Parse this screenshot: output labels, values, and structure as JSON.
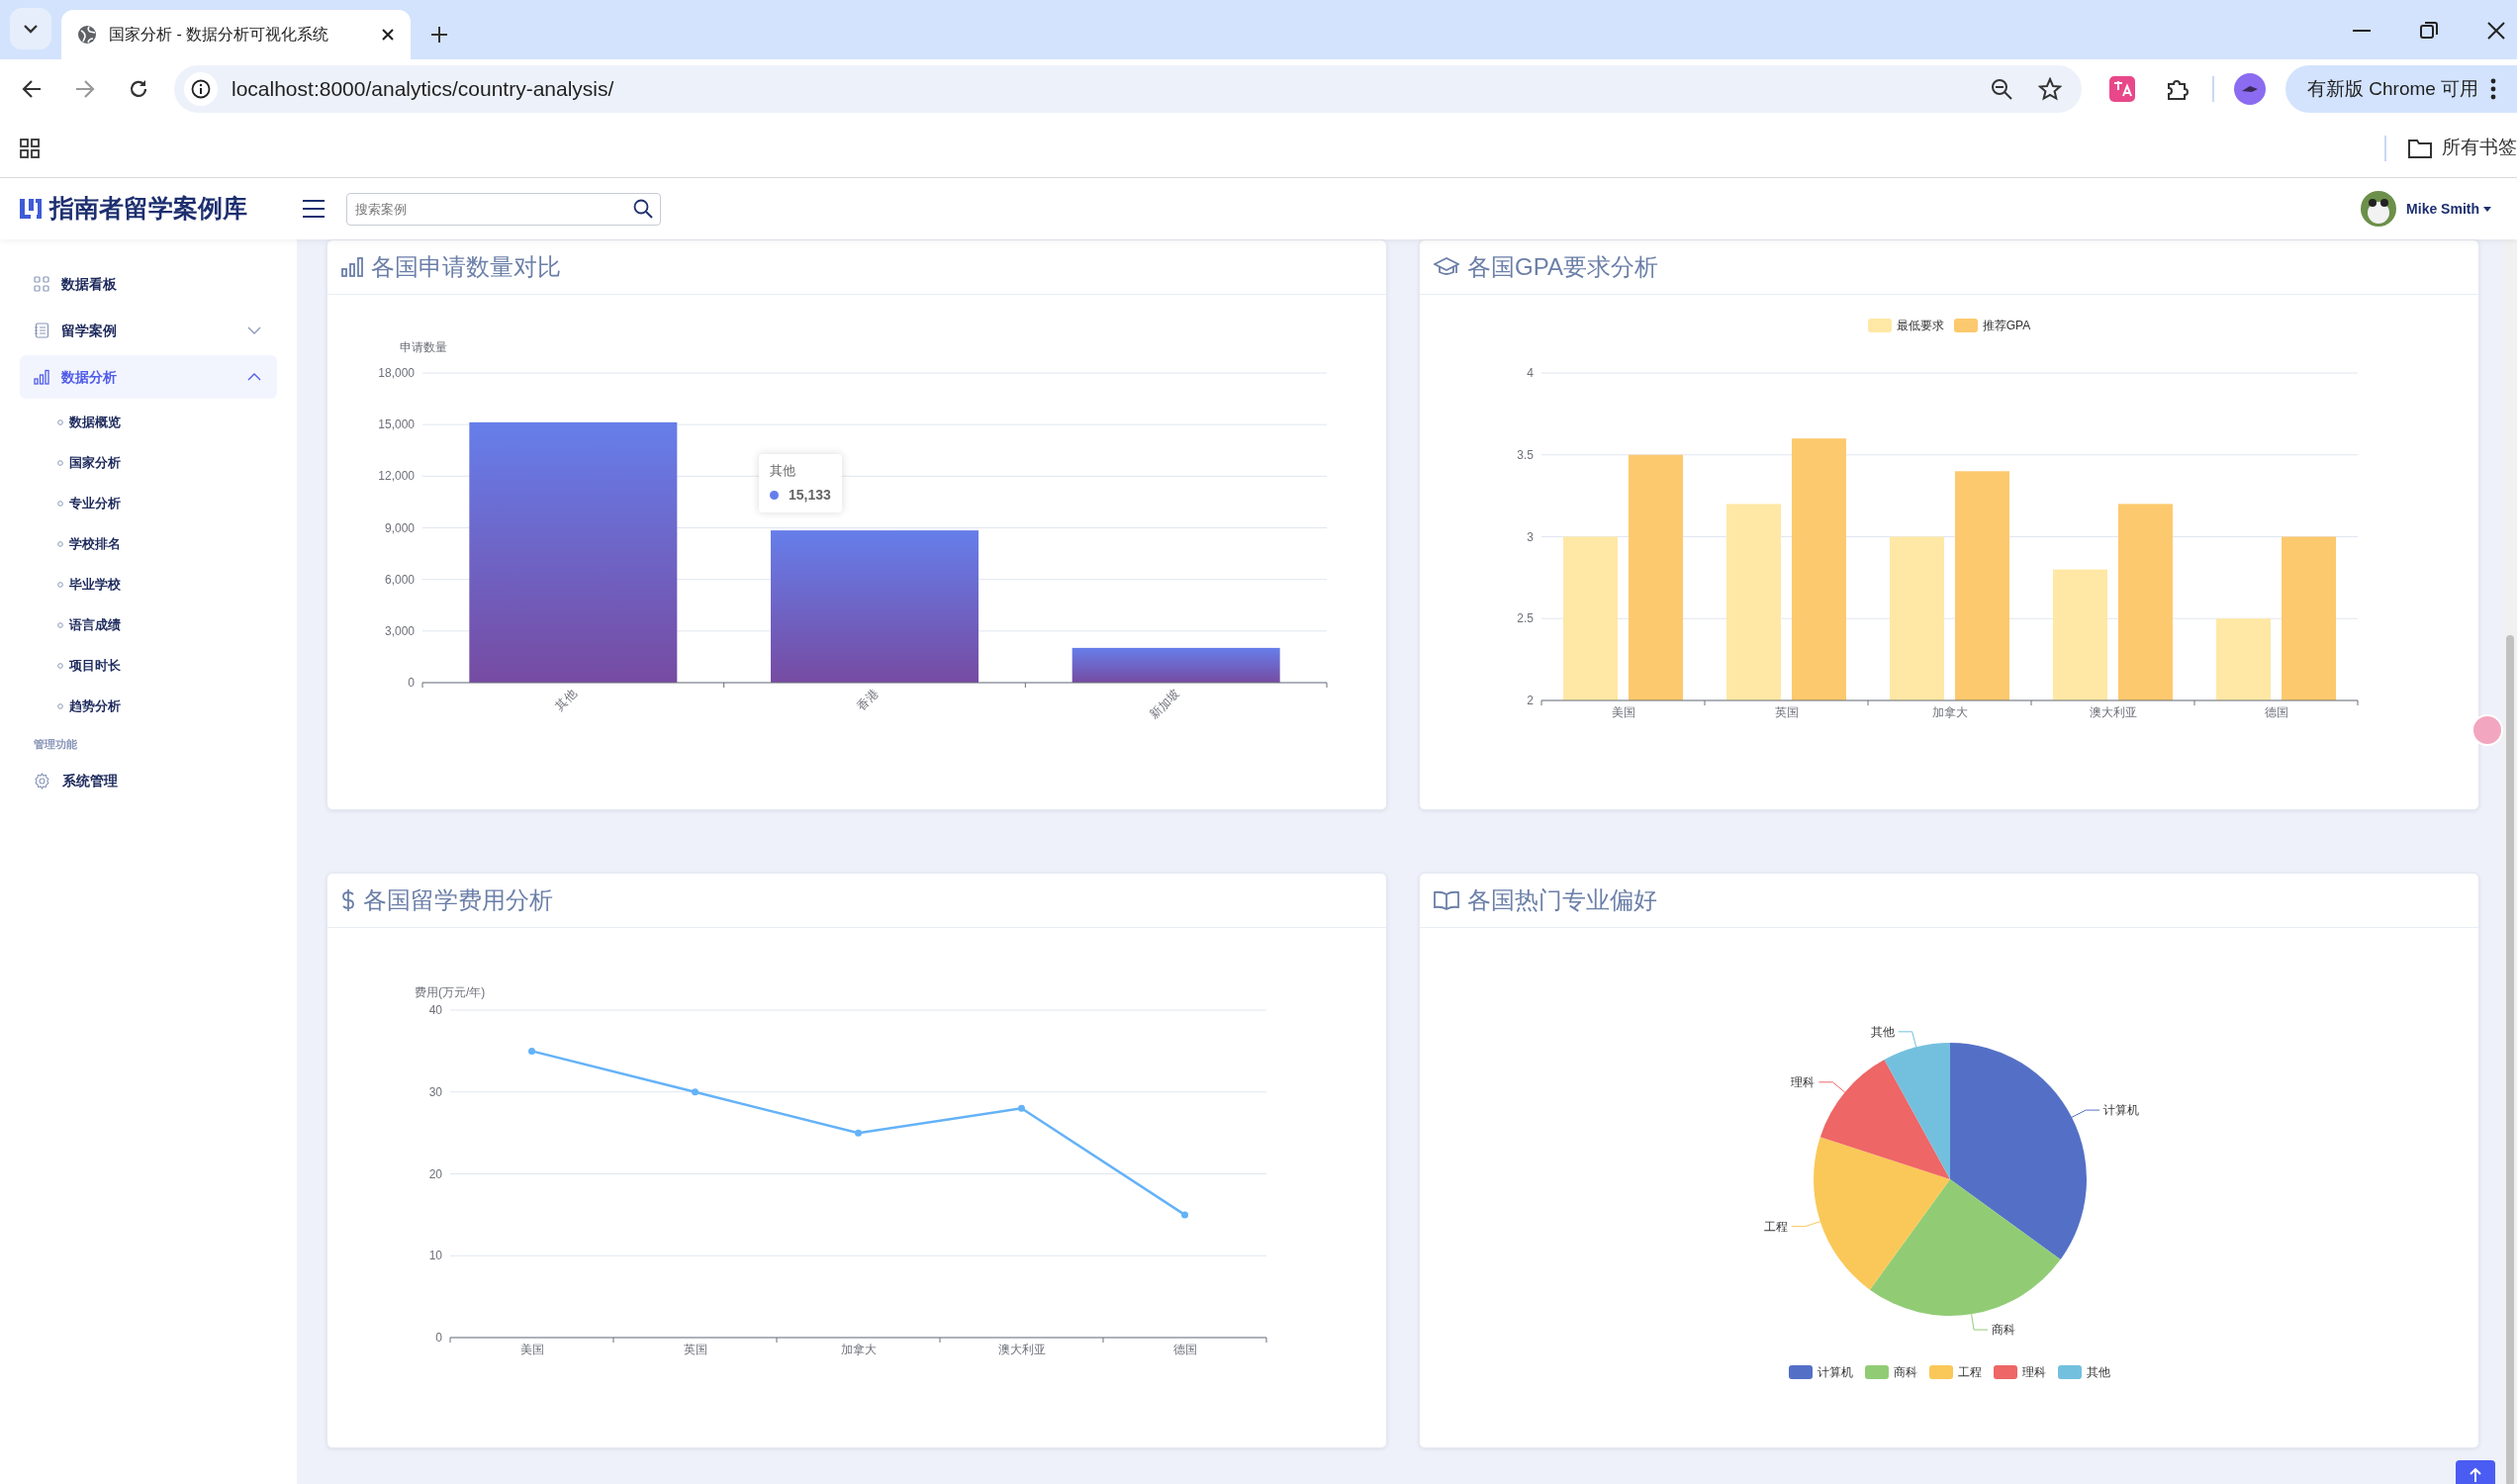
{
  "browser": {
    "tab_title": "国家分析 - 数据分析可视化系统",
    "url": "localhost:8000/analytics/country-analysis/",
    "update_button": "有新版 Chrome 可用",
    "bookmarks_label": "所有书签"
  },
  "app": {
    "logo_text": "指南者留学案例库",
    "search": {
      "placeholder": "搜索案例"
    },
    "user": {
      "name": "Mike Smith"
    }
  },
  "sidebar": {
    "items": [
      {
        "kind": "link",
        "label": "数据看板",
        "selected": false
      },
      {
        "kind": "group",
        "label": "留学案例",
        "selected": false,
        "expanded": false
      },
      {
        "kind": "group",
        "label": "数据分析",
        "selected": true,
        "expanded": true,
        "children": [
          {
            "label": "数据概览",
            "selected": false
          },
          {
            "label": "国家分析",
            "selected": false
          },
          {
            "label": "专业分析",
            "selected": false
          },
          {
            "label": "学校排名",
            "selected": false
          },
          {
            "label": "毕业学校",
            "selected": false
          },
          {
            "label": "语言成绩",
            "selected": false
          },
          {
            "label": "项目时长",
            "selected": false
          },
          {
            "label": "趋势分析",
            "selected": false
          }
        ]
      },
      {
        "kind": "section",
        "label": "管理功能"
      },
      {
        "kind": "link",
        "label": "系统管理",
        "selected": false
      }
    ]
  },
  "cards": [
    {
      "title": "各国申请数量对比",
      "chart_data": {
        "type": "bar",
        "ylabel": "申请数量",
        "categories": [
          "其他",
          "香港",
          "新加坡"
        ],
        "grid": true,
        "series": [
          {
            "color": "#667eea",
            "values": [
              15133,
              8850,
              2020
            ]
          }
        ],
        "ylim": [
          0,
          18000
        ],
        "yticks": [
          {
            "value": 0,
            "label": "0"
          },
          {
            "value": 3000,
            "label": "3,000"
          },
          {
            "value": 6000,
            "label": "6,000"
          },
          {
            "value": 9000,
            "label": "9,000"
          },
          {
            "value": 12000,
            "label": "12,000"
          },
          {
            "value": 15000,
            "label": "15,000"
          },
          {
            "value": 18000,
            "label": "18,000"
          }
        ]
      },
      "tooltip": {
        "title": "其他",
        "value": "15,133"
      }
    },
    {
      "title": "各国GPA要求分析",
      "chart_data": {
        "type": "bar",
        "categories": [
          "美国",
          "英国",
          "加拿大",
          "澳大利亚",
          "德国"
        ],
        "grid": true,
        "legend": true,
        "series": [
          {
            "name": "最低要求",
            "color": "#ffe8a5",
            "values": [
              3.0,
              3.2,
              3.0,
              2.8,
              2.5
            ]
          },
          {
            "name": "推荐GPA",
            "color": "#fdc96e",
            "values": [
              3.5,
              3.6,
              3.4,
              3.2,
              3.0
            ]
          }
        ],
        "ylim": [
          2,
          4
        ],
        "yticks": [
          2,
          2.5,
          3,
          3.5,
          4
        ]
      }
    },
    {
      "title": "各国留学费用分析",
      "chart_data": {
        "type": "line",
        "ylabel": "费用(万元/年)",
        "categories": [
          "美国",
          "英国",
          "加拿大",
          "澳大利亚",
          "德国"
        ],
        "grid": true,
        "series": [
          {
            "color": "#64b2f8",
            "marker": true,
            "values": [
              35,
              30,
              25,
              28,
              15
            ]
          }
        ],
        "ylim": [
          0,
          40
        ],
        "yticks": [
          0,
          10,
          20,
          30,
          40
        ]
      }
    },
    {
      "title": "各国热门专业偏好",
      "chart_data": {
        "type": "pie",
        "categories": [
          "计算机",
          "商科",
          "工程",
          "理科",
          "其他"
        ],
        "legend": true,
        "series": [
          {
            "values": [
              35,
              25,
              20,
              12,
              8
            ]
          }
        ],
        "colors": [
          "#5470c6",
          "#91cc75",
          "#fac858",
          "#ee6666",
          "#73c0de"
        ]
      }
    }
  ]
}
